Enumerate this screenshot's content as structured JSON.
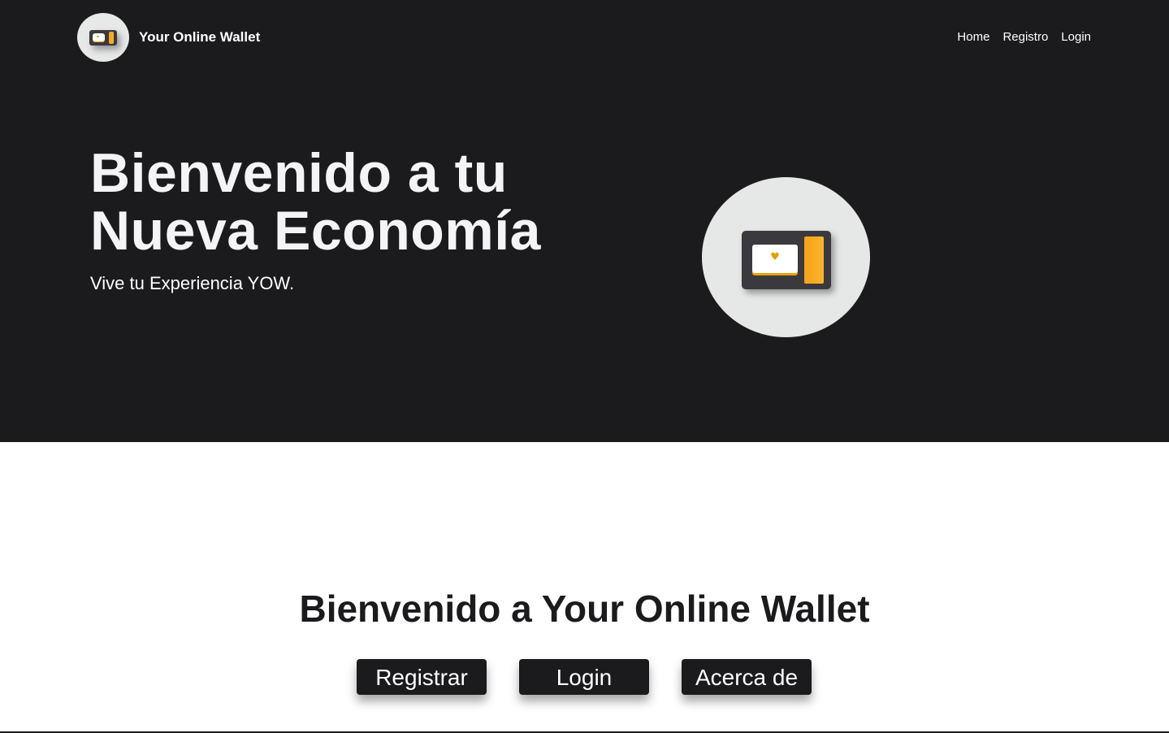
{
  "brand": {
    "name": "Your Online Wallet",
    "logo_icon": "wallet-icon"
  },
  "nav": {
    "items": [
      "Home",
      "Registro",
      "Login"
    ]
  },
  "hero": {
    "title_line1": "Bienvenido a tu",
    "title_line2": "Nueva Economía",
    "subtitle": "Vive tu Experiencia YOW.",
    "image_icon": "wallet-icon"
  },
  "welcome": {
    "title": "Bienvenido a Your Online Wallet",
    "buttons": [
      "Registrar",
      "Login",
      "Acerca de"
    ]
  },
  "colors": {
    "dark_bg": "#1b1a1d",
    "accent_orange": "#f6a217",
    "circle_bg": "#e6e7e7"
  }
}
